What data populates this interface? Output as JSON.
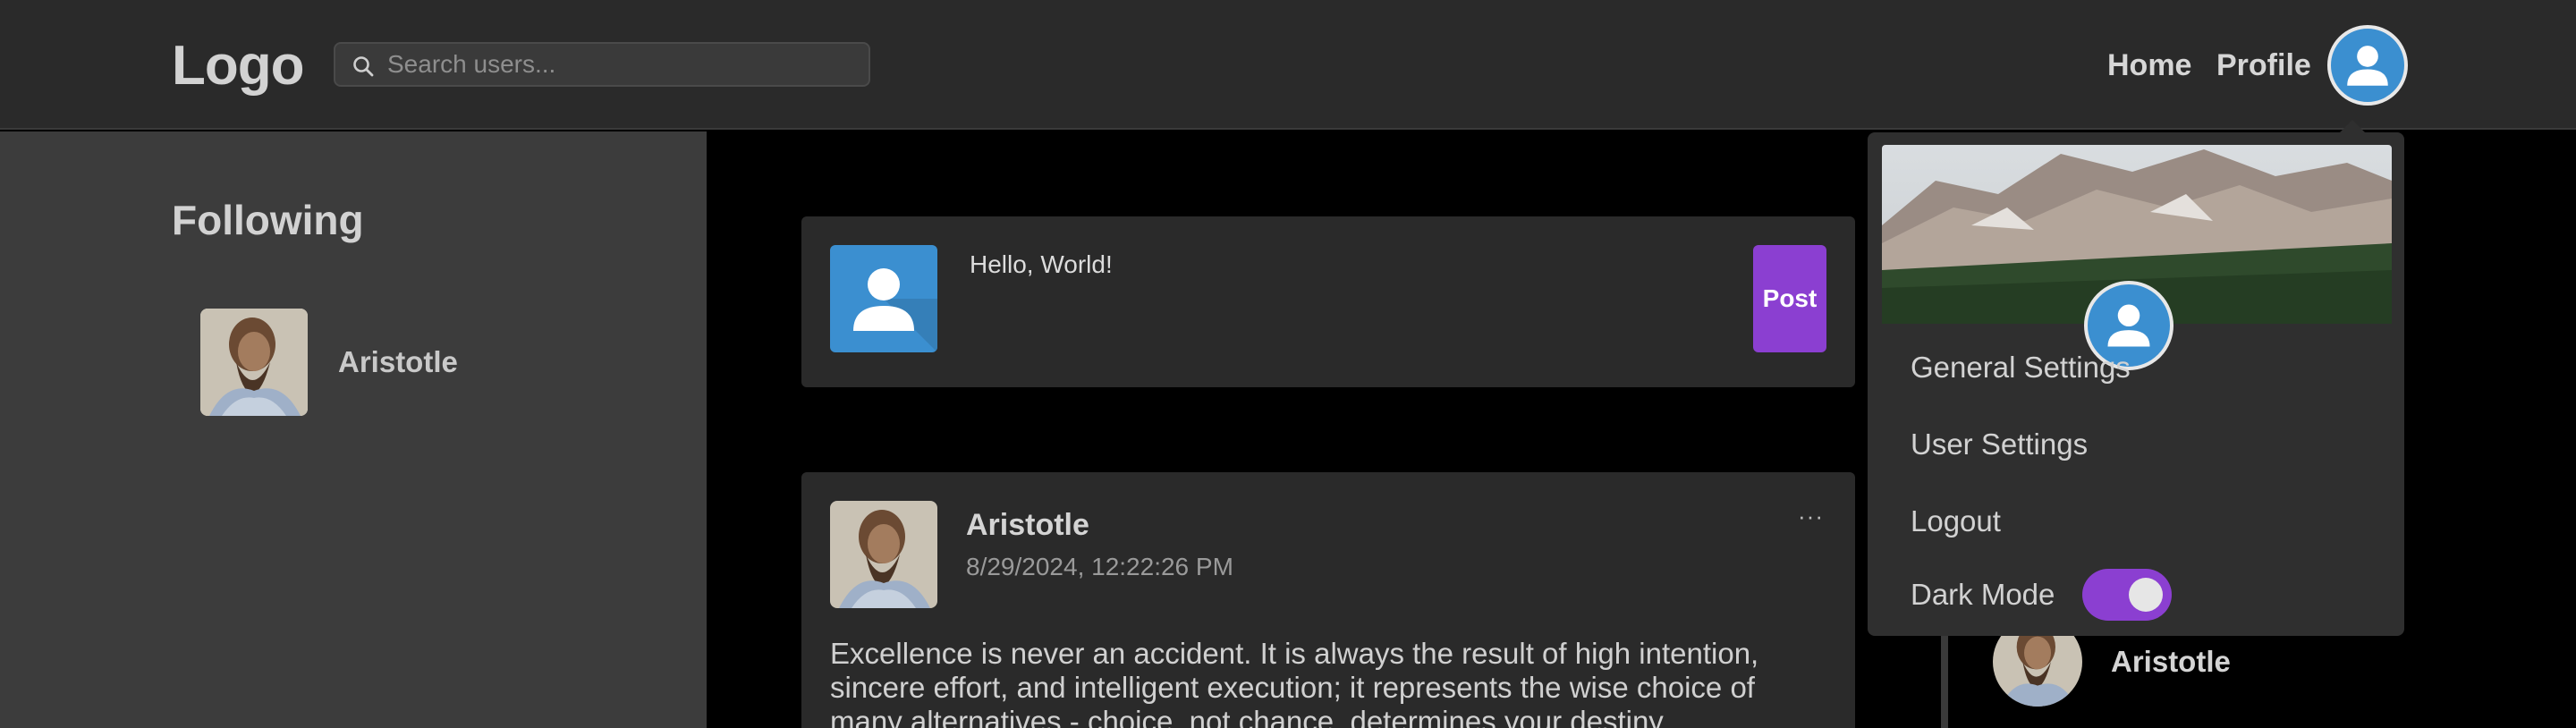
{
  "header": {
    "logo": "Logo",
    "search_placeholder": "Search users...",
    "nav": {
      "home": "Home",
      "profile": "Profile"
    }
  },
  "sidebar": {
    "title": "Following",
    "items": [
      {
        "name": "Aristotle"
      }
    ]
  },
  "composer": {
    "text": "Hello, World!",
    "post_label": "Post"
  },
  "post": {
    "author": "Aristotle",
    "timestamp": "8/29/2024, 12:22:26 PM",
    "more": "···",
    "body": "Excellence is never an accident. It is always the result of high intention, sincere effort, and intelligent execution; it represents the wise choice of many alternatives - choice, not chance, determines your destiny."
  },
  "right_panel": {
    "items": [
      {
        "name": "Aristotle"
      }
    ]
  },
  "dropdown": {
    "items": [
      {
        "label": "General Settings"
      },
      {
        "label": "User Settings"
      },
      {
        "label": "Logout"
      }
    ],
    "dark_mode": {
      "label": "Dark Mode",
      "enabled": true
    }
  },
  "colors": {
    "accent": "#8b3fd1",
    "avatar_blue": "#3b8fd0",
    "header_bg": "#2a2a2a",
    "sidebar_bg": "#3c3c3c",
    "card_bg": "#2a2a2a"
  }
}
